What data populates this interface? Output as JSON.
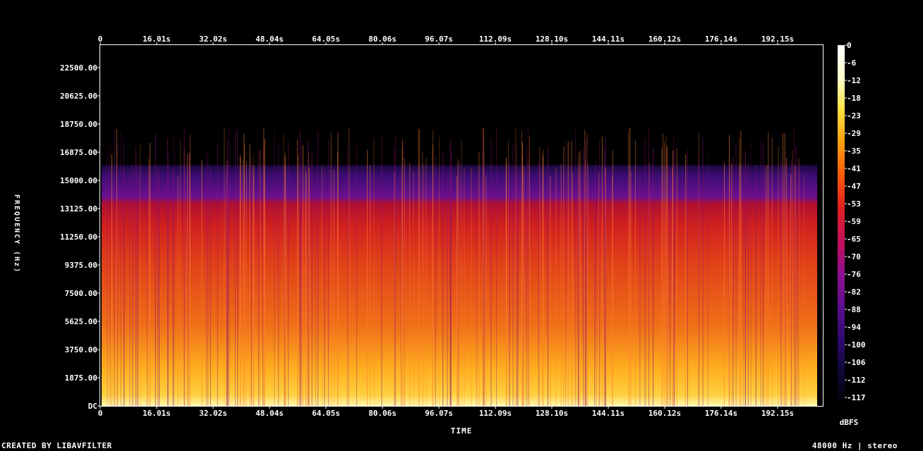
{
  "chart_data": {
    "type": "heatmap",
    "xlabel": "TIME",
    "ylabel": "FREQUENCY (Hz)",
    "x_ticks": [
      "0",
      "16.01s",
      "32.02s",
      "48.04s",
      "64.05s",
      "80.06s",
      "96.07s",
      "112.09s",
      "128.10s",
      "144.11s",
      "160.12s",
      "176.14s",
      "192.15s"
    ],
    "x_range_s": [
      0,
      205
    ],
    "y_ticks": [
      "DC",
      "1875.00",
      "3750.00",
      "5625.00",
      "7500.00",
      "9375.00",
      "11250.00",
      "13125.00",
      "15000.00",
      "16875.00",
      "18750.00",
      "20625.00",
      "22500.00"
    ],
    "y_range_hz": [
      0,
      24000
    ],
    "colorbar": {
      "label": "dBFS",
      "ticks": [
        "0",
        "-6",
        "-12",
        "-18",
        "-23",
        "-29",
        "-35",
        "-41",
        "-47",
        "-53",
        "-59",
        "-65",
        "-70",
        "-76",
        "-82",
        "-88",
        "-94",
        "-100",
        "-106",
        "-112",
        "-117"
      ],
      "range_db": [
        -117,
        0
      ],
      "colors": [
        "#000000",
        "#0e0833",
        "#2c0a6e",
        "#5a0e8c",
        "#8a1090",
        "#c01060",
        "#e0201e",
        "#ff5a0a",
        "#ffa010",
        "#ffe040",
        "#ffffd0",
        "#ffffff"
      ]
    }
  },
  "footer": {
    "creator": "CREATED BY LIBAVFILTER",
    "info": "48000 Hz | stereo"
  }
}
